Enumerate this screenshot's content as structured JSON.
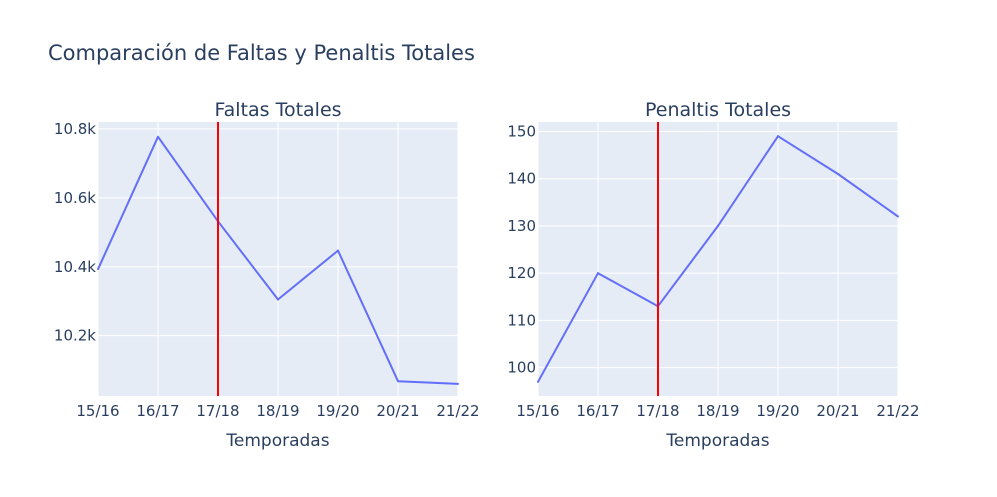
{
  "figure": {
    "title": "Comparación de Faltas y Penaltis Totales"
  },
  "colors": {
    "line": "#636efa",
    "marker_line": "#ff0000",
    "plot_bg": "#e5ecf6",
    "grid": "#ffffff",
    "text": "#2a3f5f"
  },
  "chart_data": [
    {
      "type": "line",
      "title": "Faltas Totales",
      "xlabel": "Temporadas",
      "ylabel": "",
      "categories": [
        "15/16",
        "16/17",
        "17/18",
        "18/19",
        "19/20",
        "20/21",
        "21/22"
      ],
      "values": [
        10393,
        10777,
        10532,
        10305,
        10447,
        10068,
        10060
      ],
      "ylim": [
        10025,
        10820
      ],
      "yticks": [
        10200,
        10400,
        10600,
        10800
      ],
      "ytick_labels": [
        "10.2k",
        "10.4k",
        "10.6k",
        "10.8k"
      ],
      "vline_category": "17/18",
      "grid": true
    },
    {
      "type": "line",
      "title": "Penaltis Totales",
      "xlabel": "Temporadas",
      "ylabel": "",
      "categories": [
        "15/16",
        "16/17",
        "17/18",
        "18/19",
        "19/20",
        "20/21",
        "21/22"
      ],
      "values": [
        97,
        120,
        113,
        130,
        149,
        141,
        132
      ],
      "ylim": [
        94,
        152
      ],
      "yticks": [
        100,
        110,
        120,
        130,
        140,
        150
      ],
      "ytick_labels": [
        "100",
        "110",
        "120",
        "130",
        "140",
        "150"
      ],
      "vline_category": "17/18",
      "grid": true
    }
  ]
}
